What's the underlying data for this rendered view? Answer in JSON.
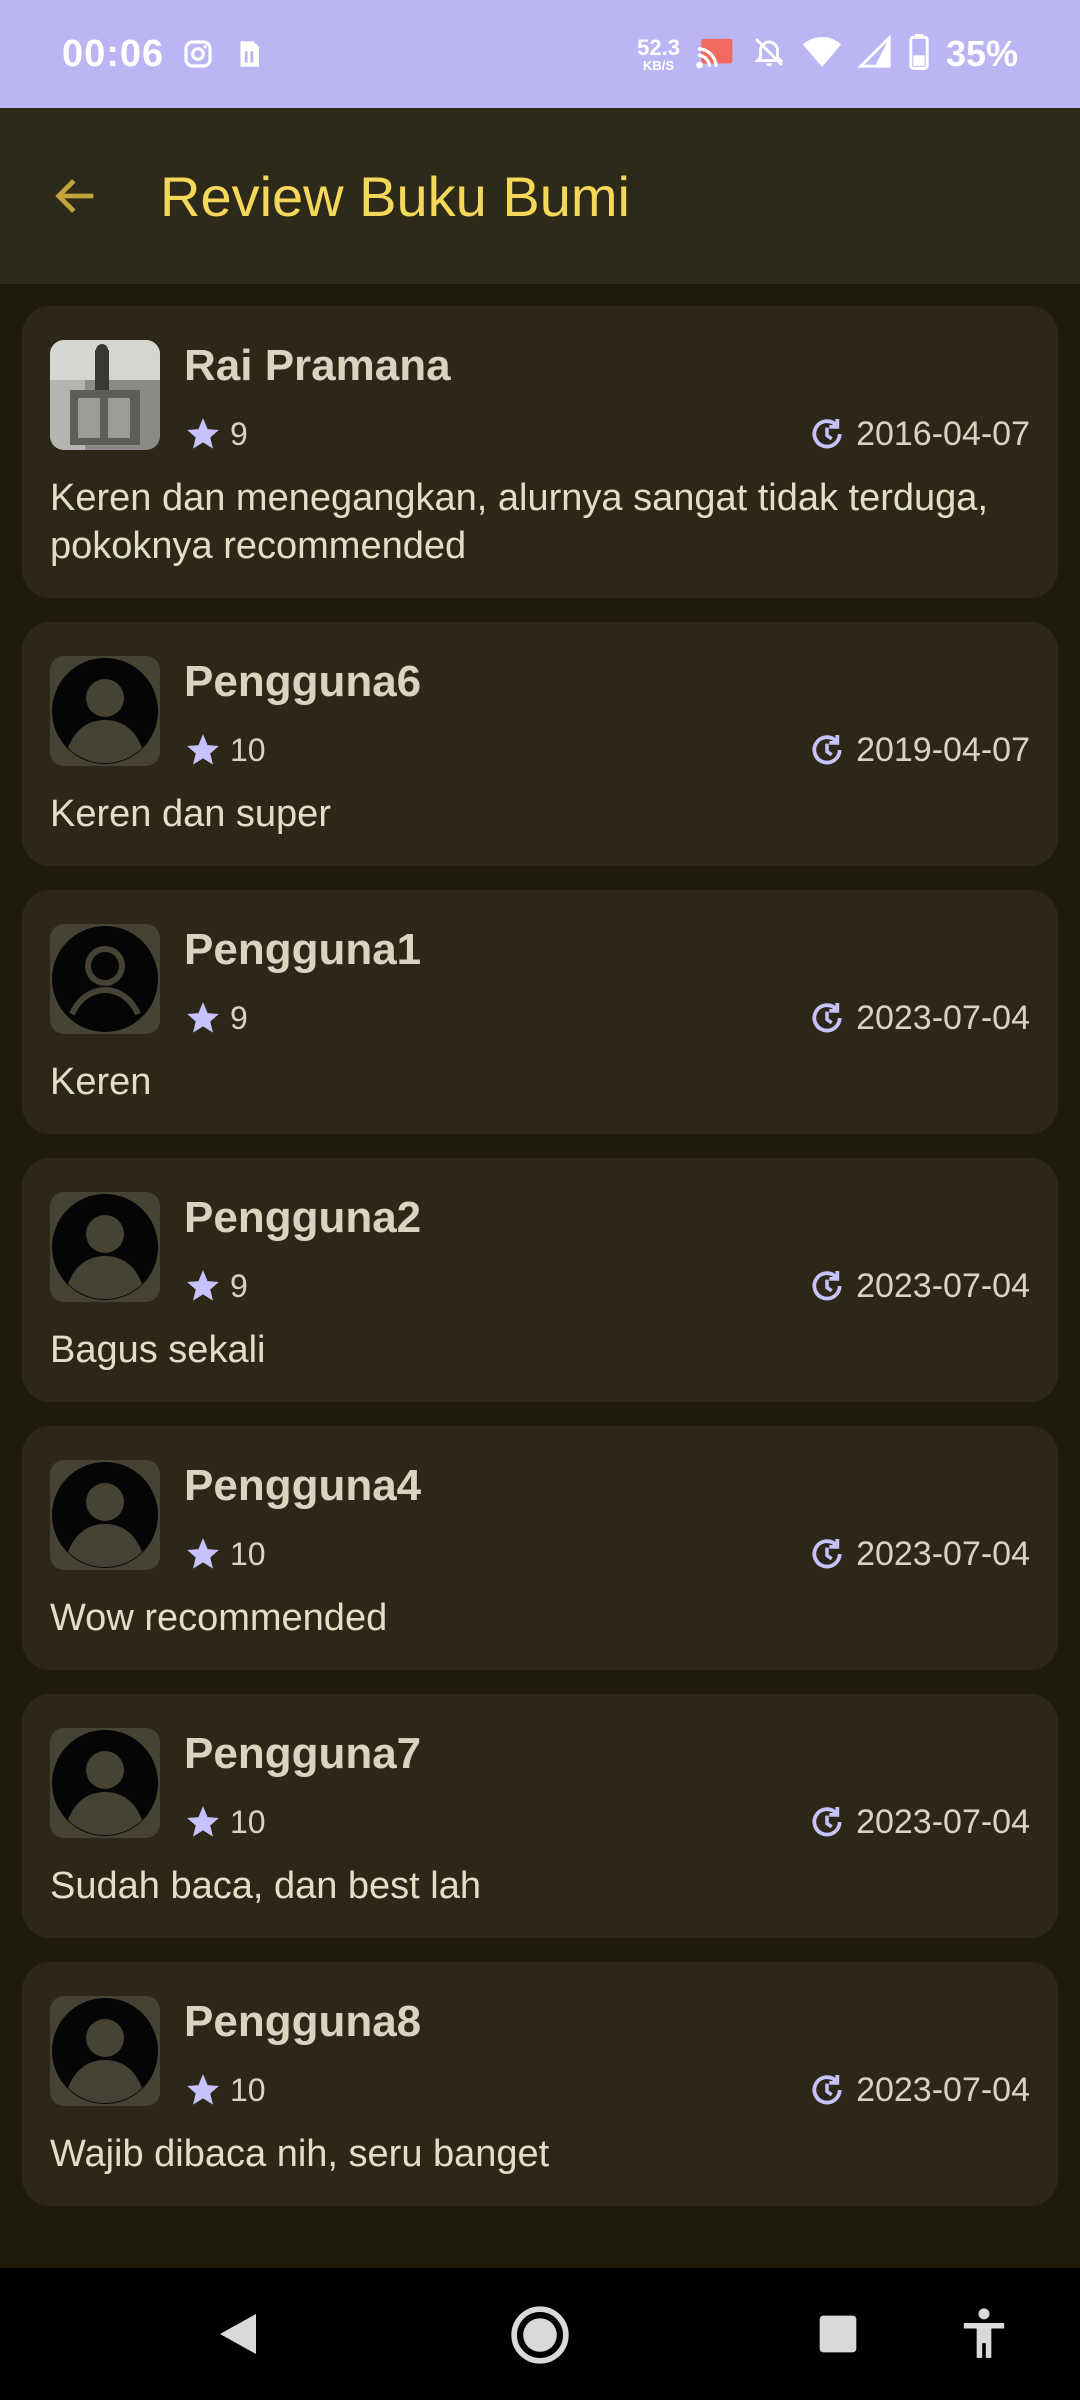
{
  "status_bar": {
    "time": "00:06",
    "net_speed_value": "52.3",
    "net_speed_unit": "KB/S",
    "battery_percent": "35%",
    "icons": [
      "instagram-icon",
      "sim-icon",
      "cast-icon",
      "bell-off-icon",
      "wifi-icon",
      "signal-icon",
      "battery-icon"
    ]
  },
  "app_bar": {
    "title": "Review Buku Bumi",
    "back_icon": "arrow-left-icon",
    "accent_color": "#f5d85a"
  },
  "reviews": [
    {
      "name": "Rai Pramana",
      "rating": "9",
      "date": "2016-04-07",
      "text": "Keren dan menegangkan, alurnya sangat tidak terduga, pokoknya recommended",
      "avatar": "photo"
    },
    {
      "name": "Pengguna6",
      "rating": "10",
      "date": "2019-04-07",
      "text": "Keren dan super",
      "avatar": "default"
    },
    {
      "name": "Pengguna1",
      "rating": "9",
      "date": "2023-07-04",
      "text": "Keren",
      "avatar": "default-outline"
    },
    {
      "name": "Pengguna2",
      "rating": "9",
      "date": "2023-07-04",
      "text": "Bagus sekali",
      "avatar": "default"
    },
    {
      "name": "Pengguna4",
      "rating": "10",
      "date": "2023-07-04",
      "text": "Wow recommended",
      "avatar": "default"
    },
    {
      "name": "Pengguna7",
      "rating": "10",
      "date": "2023-07-04",
      "text": "Sudah baca, dan best lah",
      "avatar": "default"
    },
    {
      "name": "Pengguna8",
      "rating": "10",
      "date": "2023-07-04",
      "text": "Wajib dibaca nih, seru banget",
      "avatar": "default"
    }
  ],
  "nav_bar": {
    "buttons": [
      "back-triangle-icon",
      "home-circle-icon",
      "recents-square-icon",
      "accessibility-icon"
    ]
  },
  "colors": {
    "background": "#1e1b0d",
    "card": "#2c2716",
    "status_bar": "#bcb5f3",
    "star": "#c6c1ff"
  }
}
